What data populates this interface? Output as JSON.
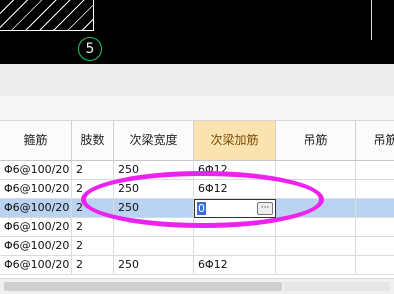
{
  "canvas": {
    "axis_label": "5"
  },
  "grid": {
    "columns": [
      "箍筋",
      "肢数",
      "次梁宽度",
      "次梁加筋",
      "吊筋",
      "吊筋"
    ],
    "active_column": "次梁加筋",
    "rows": [
      [
        "Φ6@100/20",
        "2",
        "250",
        "6Φ12",
        "",
        ""
      ],
      [
        "Φ6@100/20",
        "2",
        "250",
        "6Φ12",
        "",
        ""
      ],
      [
        "Φ6@100/20",
        "2",
        "250",
        "",
        "",
        ""
      ],
      [
        "Φ6@100/20",
        "2",
        "",
        "",
        "",
        ""
      ],
      [
        "Φ6@100/20",
        "2",
        "",
        "",
        "",
        ""
      ],
      [
        "Φ6@100/20",
        "2",
        "250",
        "6Φ12",
        "",
        ""
      ]
    ],
    "selected_row": 2,
    "editor": {
      "value": "0",
      "button_label": "···"
    }
  }
}
